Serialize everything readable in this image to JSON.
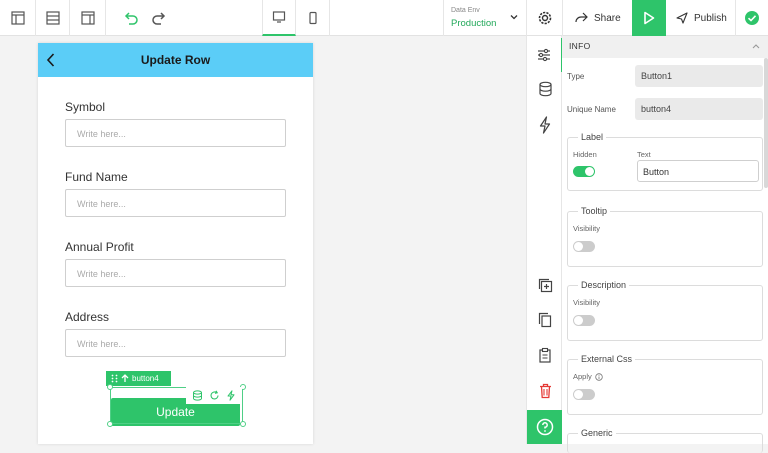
{
  "topbar": {
    "data_env_label": "Data Env",
    "data_env_value": "Production",
    "share_label": "Share",
    "publish_label": "Publish"
  },
  "phone": {
    "title": "Update Row",
    "fields": [
      {
        "label": "Symbol",
        "placeholder": "Write here..."
      },
      {
        "label": "Fund Name",
        "placeholder": "Write here..."
      },
      {
        "label": "Annual Profit",
        "placeholder": "Write here..."
      },
      {
        "label": "Address",
        "placeholder": "Write here..."
      }
    ],
    "selected_tag": "button4",
    "button_label": "Update"
  },
  "panel": {
    "section": "INFO",
    "type_label": "Type",
    "type_value": "Button1",
    "unique_label": "Unique Name",
    "unique_value": "button4",
    "label_group": "Label",
    "hidden_label": "Hidden",
    "text_label": "Text",
    "text_value": "Button",
    "tooltip_group": "Tooltip",
    "tooltip_visibility": "Visibility",
    "description_group": "Description",
    "description_visibility": "Visibility",
    "css_group": "External Css",
    "css_apply": "Apply",
    "generic_group": "Generic"
  },
  "colors": {
    "accent": "#2ec46a",
    "header": "#5bcdf7",
    "danger": "#e53935"
  }
}
